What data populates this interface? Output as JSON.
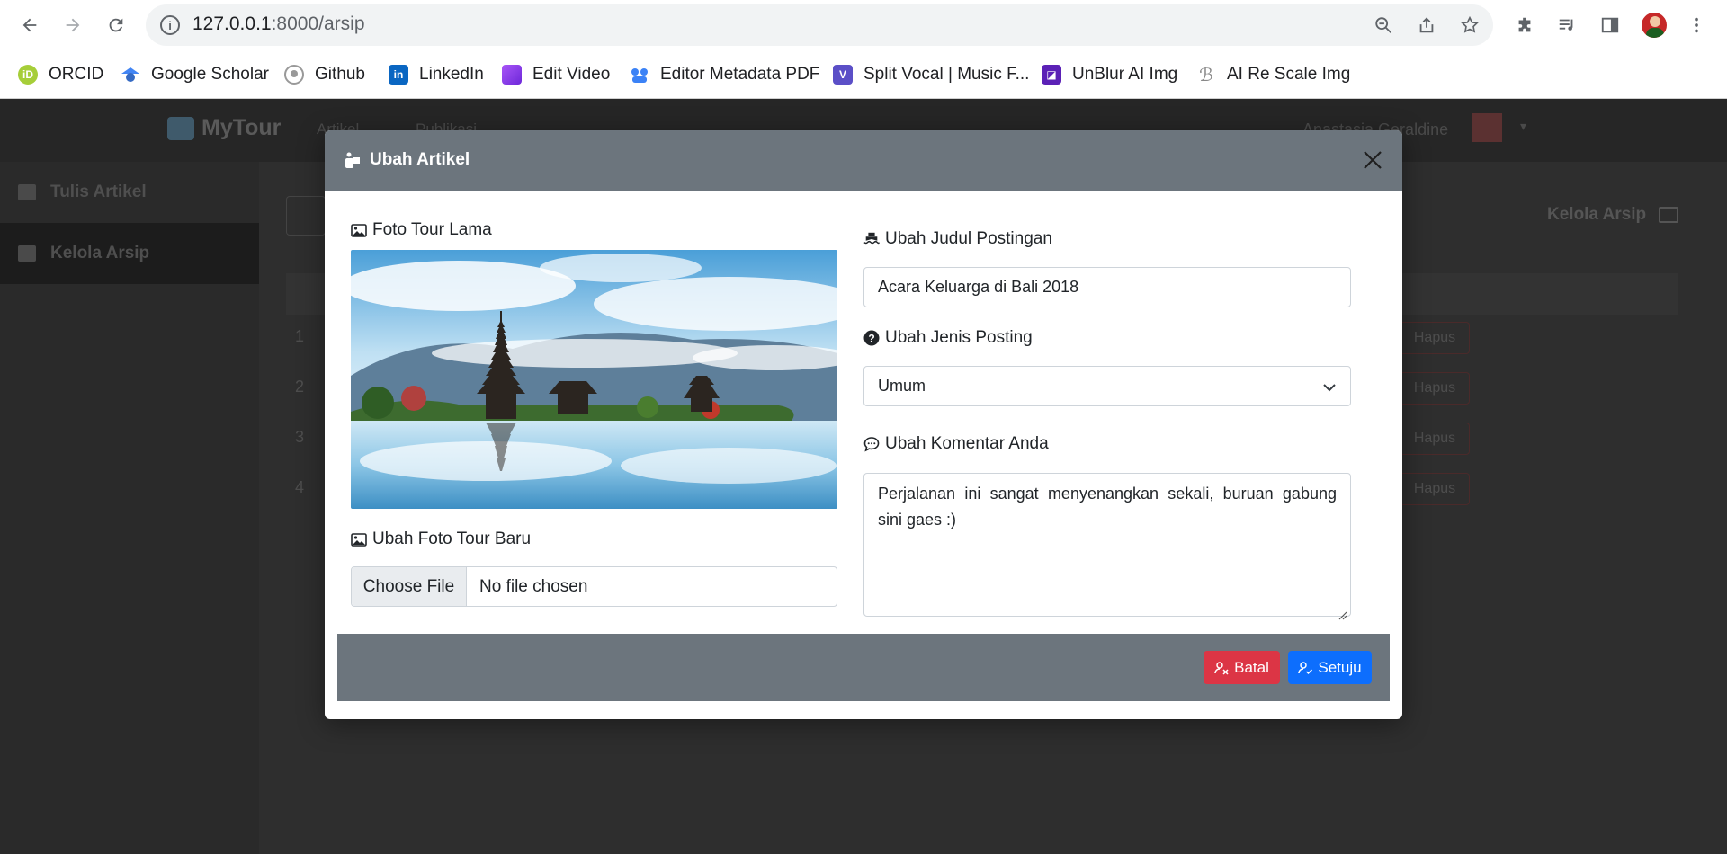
{
  "browser": {
    "url_host": "127.0.0.1",
    "url_path": ":8000/arsip",
    "bookmarks": [
      {
        "label": "ORCID",
        "icon": "orcid-icon",
        "color": "#a6ce39"
      },
      {
        "label": "Google Scholar",
        "icon": "google-scholar-icon",
        "color": "#4285f4"
      },
      {
        "label": "Github",
        "icon": "github-icon",
        "color": "#999999"
      },
      {
        "label": "LinkedIn",
        "icon": "linkedin-icon",
        "color": "#0a66c2"
      },
      {
        "label": "Edit Video",
        "icon": "edit-video-icon",
        "color": "#7b3fe4"
      },
      {
        "label": "Editor Metadata PDF",
        "icon": "metadata-icon",
        "color": "#3b82f6"
      },
      {
        "label": "Split Vocal | Music F...",
        "icon": "split-vocal-icon",
        "color": "#5b4fc7"
      },
      {
        "label": "UnBlur AI Img",
        "icon": "unblur-icon",
        "color": "#5b21b6"
      },
      {
        "label": "AI Re Scale Img",
        "icon": "rescale-icon",
        "color": "#888888"
      }
    ]
  },
  "app": {
    "brand": "MyTour",
    "nav": [
      "Artikel",
      "Publikasi"
    ],
    "user": "Anastasia Geraldine",
    "sidebar": [
      "Tulis Artikel",
      "Kelola Arsip"
    ],
    "page_heading": "Kelola Arsip",
    "rows": [
      "1",
      "2",
      "3",
      "4"
    ],
    "delete_label": "Hapus"
  },
  "modal": {
    "title": "Ubah Artikel",
    "old_photo_label": "Foto Tour Lama",
    "new_photo_label": "Ubah Foto Tour Baru",
    "file_button": "Choose File",
    "file_status": "No file chosen",
    "title_label": "Ubah Judul Postingan",
    "title_value": "Acara Keluarga di Bali 2018",
    "type_label": "Ubah Jenis Posting",
    "type_value": "Umum",
    "comment_label": "Ubah Komentar Anda",
    "comment_value": "Perjalanan ini sangat menyenangkan sekali, buruan gabung sini gaes :)",
    "cancel_label": "Batal",
    "confirm_label": "Setuju",
    "colors": {
      "header": "#6c757d",
      "danger": "#dc3545",
      "primary": "#0d6efd"
    }
  }
}
